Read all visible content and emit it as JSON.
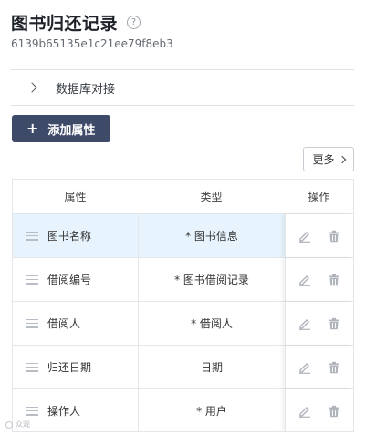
{
  "page": {
    "title": "图书归还记录",
    "record_id": "6139b65135e1c21ee79f8eb3"
  },
  "collapse": {
    "label": "数据库对接"
  },
  "toolbar": {
    "add_label": "添加属性",
    "more_label": "更多"
  },
  "table": {
    "headers": {
      "attr": "属性",
      "type": "类型",
      "ops": "操作"
    },
    "rows": [
      {
        "attr": "图书名称",
        "type": "* 图书信息",
        "selected": true
      },
      {
        "attr": "借阅编号",
        "type": "* 图书借阅记录",
        "selected": false
      },
      {
        "attr": "借阅人",
        "type": "* 借阅人",
        "selected": false
      },
      {
        "attr": "归还日期",
        "type": "日期",
        "selected": false
      },
      {
        "attr": "操作人",
        "type": "* 用户",
        "selected": false
      }
    ]
  },
  "icons": {
    "help": "help-circle-icon",
    "chevron": "chevron-right-icon",
    "plus": "plus-icon",
    "drag": "drag-handle-icon",
    "edit": "edit-pencil-icon",
    "delete": "trash-icon"
  },
  "colors": {
    "primary_button": "#3d4a68",
    "selected_row": "#e8f4fd",
    "border": "#e4e6ea",
    "icon_gray": "#b0b4bb"
  },
  "watermark": {
    "text": "众观"
  }
}
